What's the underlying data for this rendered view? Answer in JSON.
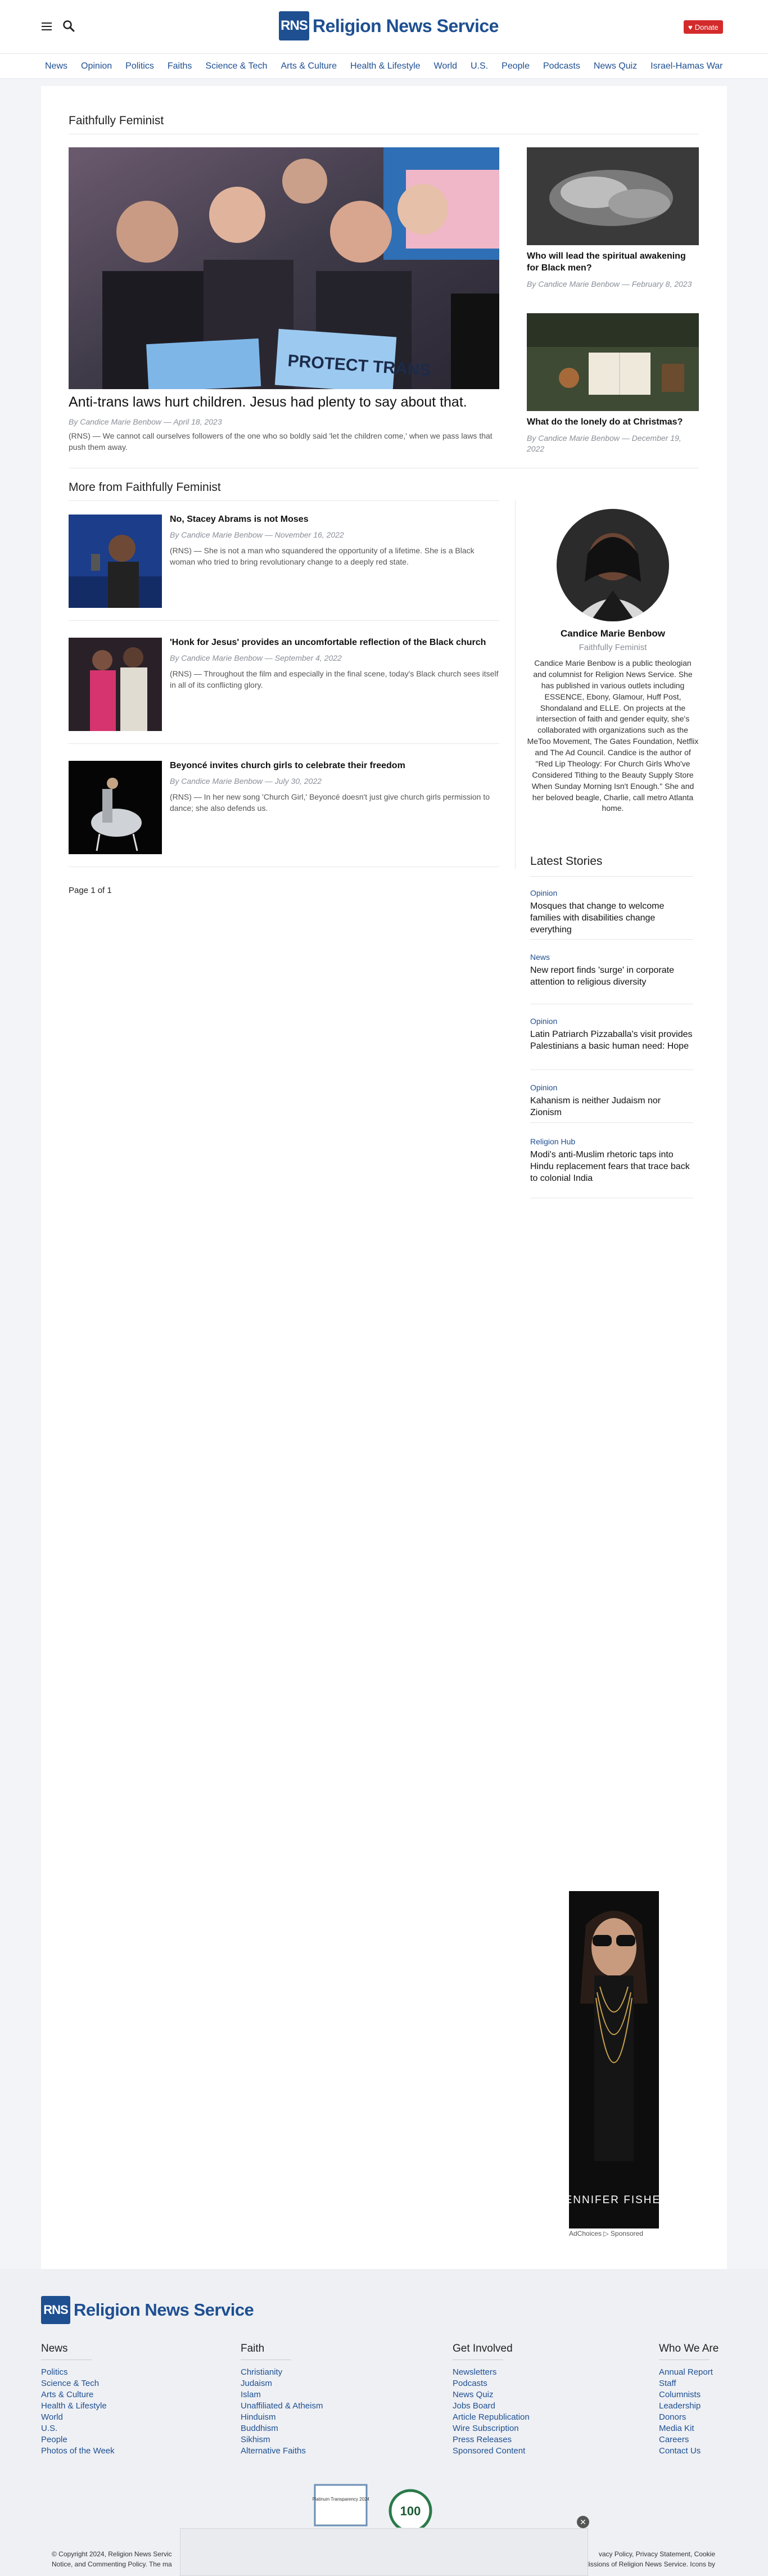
{
  "header": {
    "logo_mark": "RNS",
    "logo_text": "Religion News Service",
    "donate_label": "Donate"
  },
  "nav": [
    "News",
    "Opinion",
    "Politics",
    "Faiths",
    "Science & Tech",
    "Arts & Culture",
    "Health & Lifestyle",
    "World",
    "U.S.",
    "People",
    "Podcasts",
    "News Quiz",
    "Israel-Hamas War"
  ],
  "section_title": "Faithfully Feminist",
  "hero": {
    "title": "Anti-trans laws hurt children. Jesus had plenty to say about that.",
    "byline": "By Candice Marie Benbow — April 18, 2023",
    "excerpt": "(RNS) — We cannot call ourselves followers of the one who so boldly said 'let the children come,' when we pass laws that push them away.",
    "sign_text": "PROTECT TRANS"
  },
  "side_stories": [
    {
      "title": "Who will lead the spiritual awakening for Black men?",
      "byline": "By Candice Marie Benbow — February 8, 2023"
    },
    {
      "title": "What do the lonely do at Christmas?",
      "byline": "By Candice Marie Benbow — December 19, 2022"
    }
  ],
  "more_title": "More from Faithfully Feminist",
  "more_items": [
    {
      "title": "No, Stacey Abrams is not Moses",
      "byline": "By Candice Marie Benbow — November 16, 2022",
      "excerpt": "(RNS) — She is not a man who squandered the opportunity of a lifetime. She is a Black woman who tried to bring revolutionary change to a deeply red state."
    },
    {
      "title": "'Honk for Jesus' provides an uncomfortable reflection of the Black church",
      "byline": "By Candice Marie Benbow — September 4, 2022",
      "excerpt": "(RNS) — Throughout the film and especially in the final scene, today's Black church sees itself in all of its conflicting glory."
    },
    {
      "title": "Beyoncé invites church girls to celebrate their freedom",
      "byline": "By Candice Marie Benbow — July 30, 2022",
      "excerpt": "(RNS) — In her new song 'Church Girl,' Beyoncé doesn't just give church girls permission to dance; she also defends us."
    }
  ],
  "pager": "Page 1 of 1",
  "author": {
    "name": "Candice Marie Benbow",
    "role": "Faithfully Feminist",
    "bio": "Candice Marie Benbow is a public theologian and columnist for Religion News Service. She has published in various outlets including ESSENCE, Ebony, Glamour, Huff Post, Shondaland and ELLE. On projects at the intersection of faith and gender equity, she's collaborated with organizations such as the MeToo Movement, The Gates Foundation, Netflix and The Ad Council. Candice is the author of \"Red Lip Theology: For Church Girls Who've Considered Tithing to the Beauty Supply Store When Sunday Morning Isn't Enough.\" She and her beloved beagle, Charlie, call metro Atlanta home."
  },
  "latest": {
    "title": "Latest Stories",
    "items": [
      {
        "category": "Opinion",
        "headline": "Mosques that change to welcome families with disabilities change everything"
      },
      {
        "category": "News",
        "headline": "New report finds 'surge' in corporate attention to religious diversity"
      },
      {
        "category": "Opinion",
        "headline": "Latin Patriarch Pizzaballa's visit provides Palestinians a basic human need: Hope"
      },
      {
        "category": "Opinion",
        "headline": "Kahanism is neither Judaism nor Zionism"
      },
      {
        "category": "Religion Hub",
        "headline": "Modi's anti-Muslim rhetoric taps into Hindu replacement fears that trace back to colonial India"
      }
    ]
  },
  "ad": {
    "brand": "JENNIFER FISHER",
    "label": "AdChoices ▷ Sponsored"
  },
  "footer": {
    "logo_mark": "RNS",
    "logo_text": "Religion News Service",
    "columns": [
      {
        "title": "News",
        "links": [
          "Politics",
          "Science & Tech",
          "Arts & Culture",
          "Health & Lifestyle",
          "World",
          "U.S.",
          "People",
          "Photos of the Week"
        ]
      },
      {
        "title": "Faith",
        "links": [
          "Christianity",
          "Judaism",
          "Islam",
          "Unaffiliated & Atheism",
          "Hinduism",
          "Buddhism",
          "Sikhism",
          "Alternative Faiths"
        ]
      },
      {
        "title": "Get Involved",
        "links": [
          "Newsletters",
          "Podcasts",
          "News Quiz",
          "Jobs Board",
          "Article Republication",
          "Wire Subscription",
          "Press Releases",
          "Sponsored Content"
        ]
      },
      {
        "title": "Who We Are",
        "links": [
          "Annual Report",
          "Staff",
          "Columnists",
          "Leadership",
          "Donors",
          "Media Kit",
          "Careers",
          "Contact Us"
        ]
      }
    ],
    "badge1": "Platinum Transparency 2024",
    "badge2": "100",
    "copyright_left": "© Copyright 2024, Religion News Servic",
    "copyright_left2": "Notice, and Commenting Policy. The ma",
    "copyright_right": "vacy Policy, Privacy Statement, Cookie",
    "copyright_right2": "lissions of Religion News Service. Icons by"
  },
  "colors": {
    "brand": "#1e4f91",
    "donate": "#d32b2b",
    "link": "#1e4f91"
  }
}
